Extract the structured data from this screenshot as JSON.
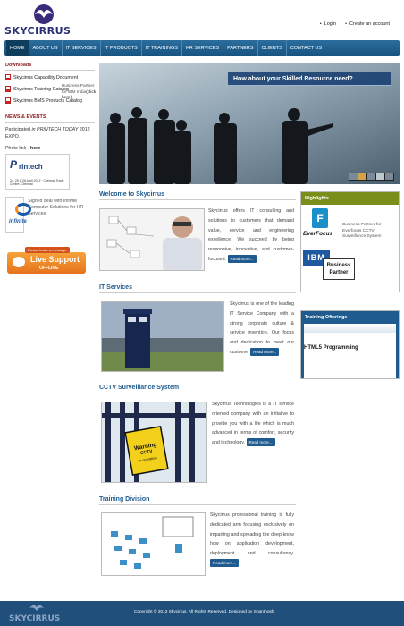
{
  "header": {
    "brand": "SKYCIRRUS",
    "links": [
      "Login",
      "Create an account"
    ]
  },
  "nav": [
    "HOME",
    "ABOUT US",
    "IT SERVICES",
    "IT PRODUCTS",
    "IT TRAININGS",
    "HR SERVICES",
    "PARTNERS",
    "CLIENTS",
    "CONTACT US"
  ],
  "sidebar": {
    "downloads_heading": "Downloads",
    "downloads": [
      "Skycirrus Capability Document",
      "Skycirrus Training Catalog",
      "Skycirrus BMS Products Catalog"
    ],
    "news_heading": "NEWS & EVENTS",
    "news_prefix": "Participated ",
    "news_event": "in PRINTECH TODAY",
    "news_suffix": " 2012 EXPO.",
    "photo_link_label": "Photo link - ",
    "photo_link_here": "here",
    "printech": {
      "p": "P",
      "word": "rintech",
      "sub": "24, 25 & 26 April 2012 · Chennai Trade Centre, Chennai"
    },
    "infinite": {
      "logo_text": "infinite",
      "desc": "Signed deal with Infinite Computer Solutions for HR Services"
    },
    "live_support": {
      "top": "Please leave a message",
      "label": "Live Support",
      "status": "OFFLINE"
    }
  },
  "banner": {
    "caption": "How about your Skilled Resource need?"
  },
  "sections": [
    {
      "title": "Welcome to Skycirrus",
      "text": "Skycirrus offers IT consulting and solutions to customers that demand value, service and engineering excellence. We succeed by being responsive, innovative, and customer-focused.",
      "more": "Read more..."
    },
    {
      "title": "IT Services",
      "text": "Skycirrus is one of the leading IT Service Company with a strong corporate culture & service invention. Our focus and dedication to meet our customer",
      "more": "Read more..."
    },
    {
      "title": "CCTV Surveillance System",
      "text": "Skycirrus Technologies is a IT service oriented company with an initiative to provide you with a life which is much advanced in terms of comfort, security and technology.",
      "more": "Read more..."
    },
    {
      "title": "Training Division",
      "text": "Skycirrus professional training is fully dedicated arm focusing exclusively on imparting and spreading the deep know how on application development, deployment and consultancy.",
      "more": "Read more..."
    }
  ],
  "cctv_sign": {
    "line1": "Warning",
    "line2": "CCTV",
    "line3": "in operation"
  },
  "highlights": {
    "heading": "Highlights",
    "everfocus": {
      "letter": "F",
      "name": "EverFocus",
      "text": "Business Partner for Everfocus CCTV Surveillance System"
    },
    "ibm": {
      "logo": "IBM",
      "badge": "Business Partner",
      "text": "Business Partner for IBM India",
      "link": "(click here)"
    }
  },
  "training": {
    "heading": "Training Offerings",
    "item": "HTML5 Programming"
  },
  "footer": {
    "brand": "SKYCIRRUS",
    "copyright": "Copyright © 2012 Skycirrus. All Rights Reserved. Designed by Shanthosh."
  },
  "colors": {
    "nav": "#17537f",
    "heading": "#1f5b8f",
    "highlight": "#7a8f1b",
    "news": "#8b1a1a",
    "footer": "#1f4f7a"
  }
}
